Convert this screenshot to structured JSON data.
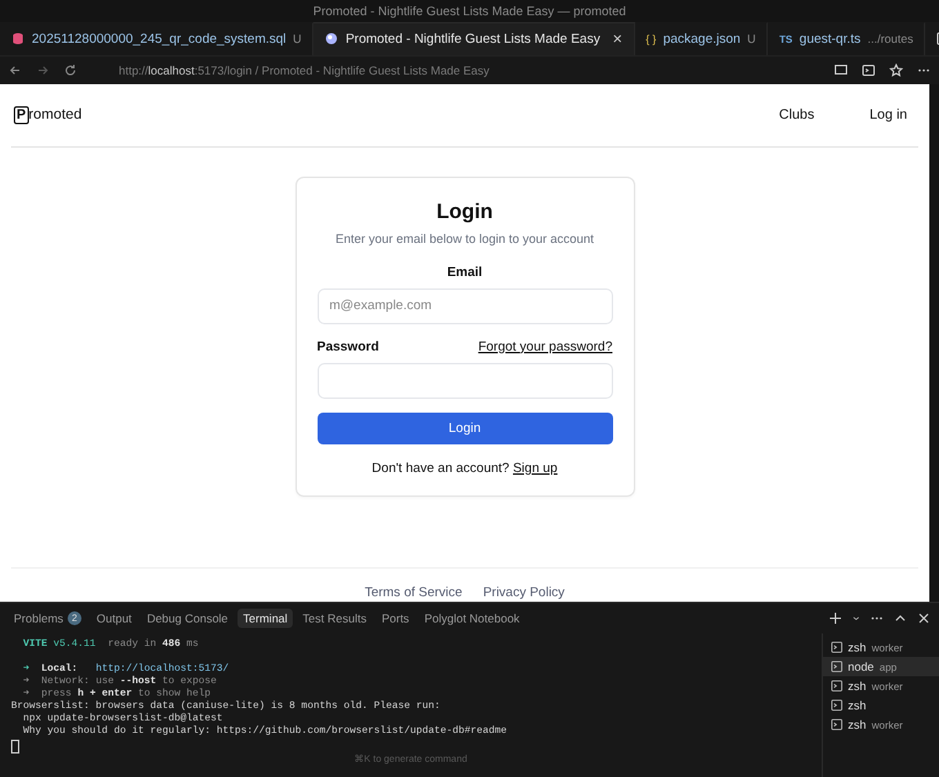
{
  "window": {
    "title": "Promoted - Nightlife Guest Lists Made Easy — promoted"
  },
  "editor_tabs": [
    {
      "kind": "sql",
      "label": "20251128000000_245_qr_code_system.sql",
      "badge": "U",
      "selected": false
    },
    {
      "kind": "web",
      "label": "Promoted - Nightlife Guest Lists Made Easy",
      "close": "×",
      "selected": true
    },
    {
      "kind": "json",
      "icon_text": "{ }",
      "label": "package.json",
      "badge": "U",
      "selected": false
    },
    {
      "kind": "ts",
      "icon_text": "TS",
      "label": "guest-qr.ts",
      "detail": ".../routes",
      "selected": false
    }
  ],
  "address_bar": {
    "host": "localhost",
    "port_path": ":5173/login",
    "page_title": "/ Promoted - Nightlife Guest Lists Made Easy",
    "scheme": "http://"
  },
  "site": {
    "logo_mark": "P",
    "logo_text": "romoted",
    "nav": [
      "Clubs",
      "Log in"
    ],
    "login": {
      "title": "Login",
      "subtitle": "Enter your email below to login to your account",
      "email_label": "Email",
      "email_placeholder": "m@example.com",
      "password_label": "Password",
      "forgot_link": "Forgot your password?",
      "submit": "Login",
      "signup_prompt": "Don't have an account?",
      "signup_link": "Sign up"
    },
    "footer_links": [
      "Terms of Service",
      "Privacy Policy"
    ]
  },
  "panel_tabs": [
    {
      "label": "Problems",
      "count": "2",
      "selected": false
    },
    {
      "label": "Output",
      "selected": false
    },
    {
      "label": "Debug Console",
      "selected": false
    },
    {
      "label": "Terminal",
      "selected": true
    },
    {
      "label": "Test Results",
      "selected": false
    },
    {
      "label": "Ports",
      "selected": false
    },
    {
      "label": "Polyglot Notebook",
      "selected": false
    }
  ],
  "terminal": {
    "lines": [
      [
        {
          "kind": "vite",
          "text": "  VITE"
        },
        {
          "kind": "vite_dim",
          "text": " v5.4.11"
        },
        {
          "kind": "dim",
          "text": "  ready in "
        },
        {
          "kind": "bold",
          "text": "486"
        },
        {
          "kind": "dim",
          "text": " ms"
        }
      ],
      [
        {
          "kind": "gap"
        },
        {
          "kind": "green",
          "text": "  ➜"
        },
        {
          "kind": "bold",
          "text": "  Local:"
        },
        {
          "kind": "link",
          "text": "   http://localhost:5173/"
        }
      ],
      [
        {
          "kind": "dim",
          "text": "  ➜  Network: use "
        },
        {
          "kind": "bold",
          "text": "--host"
        },
        {
          "kind": "dim",
          "text": " to expose"
        }
      ],
      [
        {
          "kind": "dim",
          "text": "  ➜  press "
        },
        {
          "kind": "bold",
          "text": "h + enter"
        },
        {
          "kind": "dim",
          "text": " to show help"
        }
      ],
      [
        {
          "kind": "plain",
          "text": "Browserslist: browsers data (caniuse-lite) is 8 months old. Please run:"
        }
      ],
      [
        {
          "kind": "plain",
          "text": "  npx update-browserslist-db@latest"
        }
      ],
      [
        {
          "kind": "plain",
          "text": "  Why you should do it regularly: https://github.com/browserslist/update-db#readme"
        }
      ]
    ],
    "hint": "⌘K to generate command",
    "sessions": [
      {
        "name": "zsh",
        "detail": "worker",
        "selected": false
      },
      {
        "name": "node",
        "detail": "app",
        "selected": true
      },
      {
        "name": "zsh",
        "detail": "worker",
        "selected": false
      },
      {
        "name": "zsh",
        "selected": false
      },
      {
        "name": "zsh",
        "detail": "worker",
        "selected": false
      }
    ]
  }
}
